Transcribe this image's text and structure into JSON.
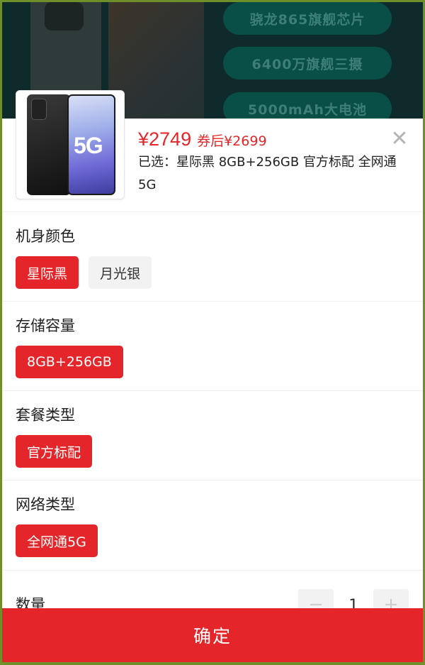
{
  "banner": {
    "features": [
      "骁龙865旗舰芯片",
      "6400万旗舰三摄",
      "5000mAh大电池"
    ]
  },
  "product": {
    "thumb_badge": "5G",
    "price": "¥2749",
    "after_coupon": "券后¥2699",
    "selected_text": "已选：星际黑 8GB+256GB 官方标配 全网通5G"
  },
  "sections": {
    "color": {
      "title": "机身颜色",
      "options": [
        "星际黑",
        "月光银"
      ],
      "selected": "星际黑"
    },
    "storage": {
      "title": "存储容量",
      "options": [
        "8GB+256GB"
      ],
      "selected": "8GB+256GB"
    },
    "package": {
      "title": "套餐类型",
      "options": [
        "官方标配"
      ],
      "selected": "官方标配"
    },
    "network": {
      "title": "网络类型",
      "options": [
        "全网通5G"
      ],
      "selected": "全网通5G"
    }
  },
  "quantity": {
    "label": "数量",
    "value": "1",
    "minus": "−",
    "plus": "+"
  },
  "confirm_label": "确定",
  "close_glyph": "✕",
  "colors": {
    "accent": "#e4262a",
    "frame": "#6e8f2a"
  }
}
